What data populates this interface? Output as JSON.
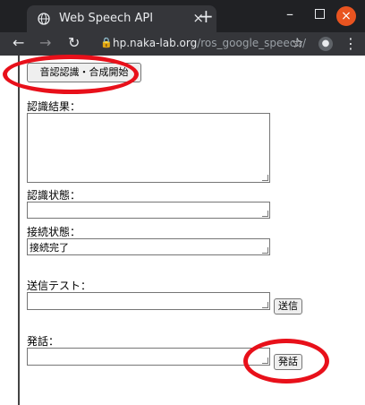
{
  "browser": {
    "tab_title": "Web Speech API",
    "tab_close": "×",
    "new_tab": "+",
    "minimize": "–",
    "close": "×",
    "url_host": "hp.naka-lab.org",
    "url_path": "/ros_google_speech/",
    "back": "←",
    "forward": "→",
    "reload": "↻",
    "lock": "🔒",
    "bookmark": "☆",
    "profile": "●",
    "menu": "⋮"
  },
  "page": {
    "start_button": "音認認識・合成開始",
    "result_label": "認識結果：",
    "result_value": "",
    "state_label": "認識状態：",
    "state_value": "",
    "connection_label": "接続状態：",
    "connection_value": "接続完了",
    "send_test_label": "送信テスト：",
    "send_test_value": "",
    "send_button": "送信",
    "speech_label": "発話：",
    "speech_value": "",
    "speak_button": "発話"
  },
  "colors": {
    "annotation": "#e8101a",
    "titlebar": "#202124",
    "toolbar": "#35363a"
  },
  "icons": [
    "globe-icon",
    "lock-icon",
    "star-icon",
    "profile-icon",
    "menu-icon"
  ]
}
